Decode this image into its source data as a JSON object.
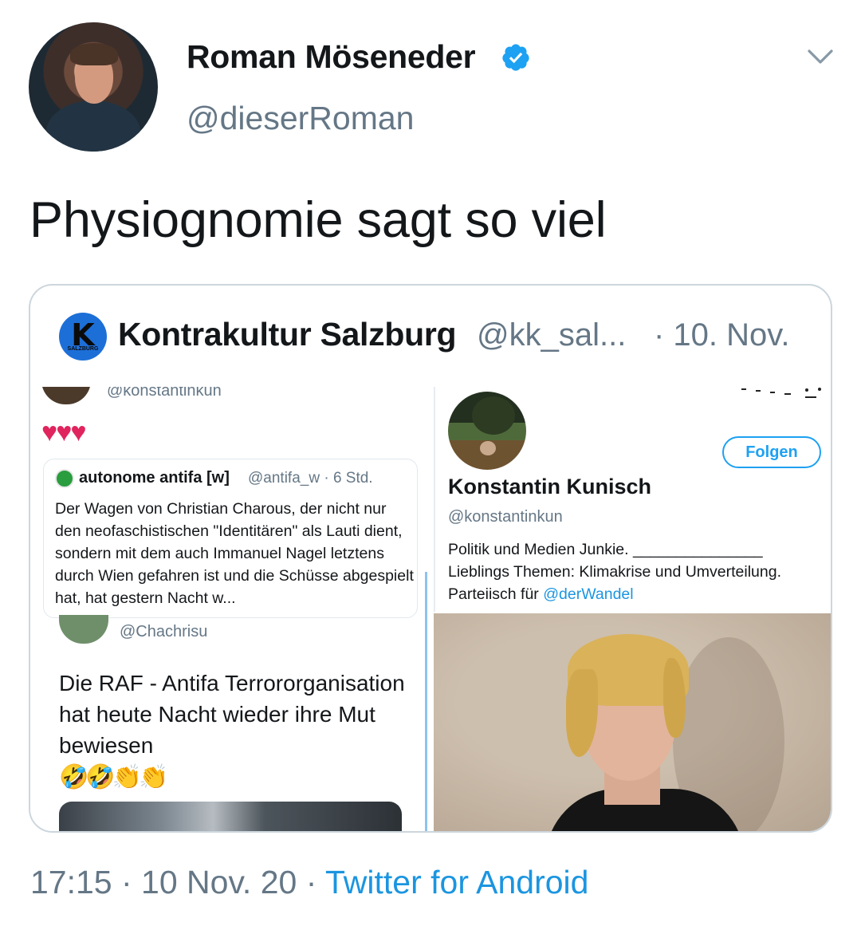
{
  "tweet": {
    "author_name": "Roman Möseneder",
    "author_handle": "@dieserRoman",
    "text": "Physiognomie sagt so viel",
    "time": "17:15",
    "date": "10 Nov. 20",
    "source": "Twitter for Android",
    "separator": " · "
  },
  "quoted": {
    "avatar_letters": "K",
    "avatar_sub": "SALZBURG",
    "name": "Kontrakultur Salzburg",
    "handle": "@kk_sal...",
    "date": "· 10. Nov.",
    "left_panel": {
      "top_handle": "@konstantinkun",
      "hearts": "♥♥♥",
      "inner_quote": {
        "name": "autonome antifa [w]",
        "meta": "@antifa_w · 6 Std.",
        "text": "Der Wagen von Christian Charous, der nicht nur den neofaschistischen \"Identitären\" als Lauti dient, sondern mit dem auch Immanuel Nagel letztens durch Wien gefahren ist und die Schüsse abgespielt hat, hat gestern Nacht w..."
      },
      "reply": {
        "handle": "@Chachrisu",
        "text": "Die RAF - Antifa Terrororganisation hat heute Nacht wieder ihre Mut bewiesen",
        "emoji": "🤣🤣👏👏"
      }
    },
    "right_panel": {
      "follow_label": "Folgen",
      "name": "Konstantin Kunisch",
      "handle": "@konstantinkun",
      "bio_line1": "Politik und Medien Junkie. _______________",
      "bio_line2": "Lieblings Themen: Klimakrise und Umverteilung.",
      "bio_line3_prefix": "Parteiisch für ",
      "bio_mention": "@derWandel"
    }
  },
  "colors": {
    "text_primary": "#14171a",
    "text_secondary": "#657786",
    "link_blue": "#1b95e0",
    "verified_blue": "#1da1f2",
    "border": "#ccd6dd",
    "heart_red": "#e0245e"
  },
  "icons": {
    "verified": "verified-badge-icon",
    "menu": "chevron-down-icon"
  }
}
